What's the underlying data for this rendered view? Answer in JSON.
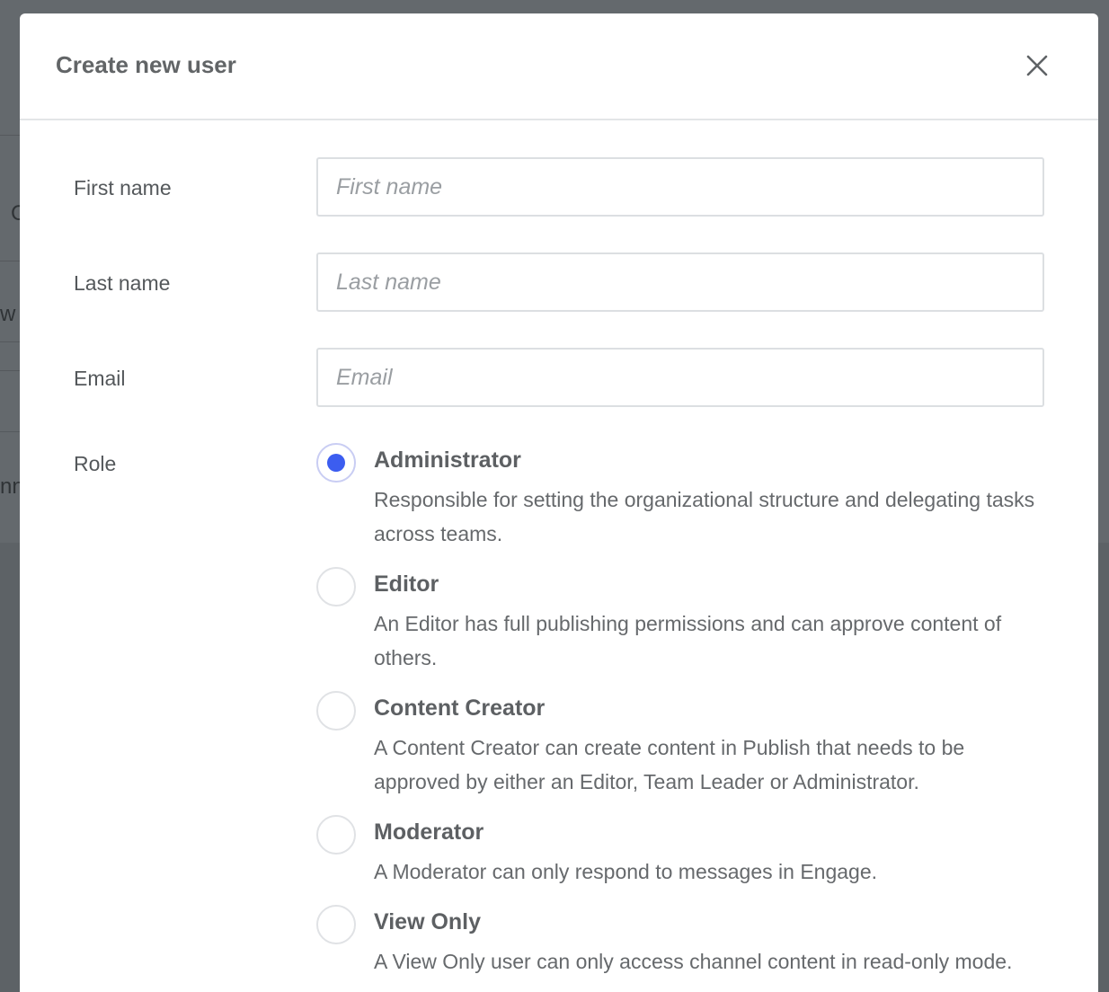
{
  "modal": {
    "title": "Create new user"
  },
  "form": {
    "first_name": {
      "label": "First name",
      "placeholder": "First name",
      "value": ""
    },
    "last_name": {
      "label": "Last name",
      "placeholder": "Last name",
      "value": ""
    },
    "email": {
      "label": "Email",
      "placeholder": "Email",
      "value": ""
    },
    "role": {
      "label": "Role",
      "selected": "Administrator",
      "options": [
        {
          "title": "Administrator",
          "description": "Responsible for setting the organizational structure and delegating tasks across teams.",
          "checked": true
        },
        {
          "title": "Editor",
          "description": "An Editor has full publishing permissions and can approve content of others.",
          "checked": false
        },
        {
          "title": "Content Creator",
          "description": "A Content Creator can create content in Publish that needs to be approved by either an Editor, Team Leader or Administrator.",
          "checked": false
        },
        {
          "title": "Moderator",
          "description": "A Moderator can only respond to messages in Engage.",
          "checked": false
        },
        {
          "title": "View Only",
          "description": "A View Only user can only access channel content in read-only mode.",
          "checked": false
        }
      ]
    }
  },
  "background": {
    "fragments": [
      "C",
      "w",
      "nn"
    ]
  },
  "colors": {
    "accent": "#3c5df0",
    "overlay": "#5d6266",
    "modal_bg": "#ffffff",
    "text_label": "#54585b",
    "text_desc": "#66696c",
    "border": "#dcdfe2"
  },
  "icons": {
    "close": "close-icon"
  }
}
